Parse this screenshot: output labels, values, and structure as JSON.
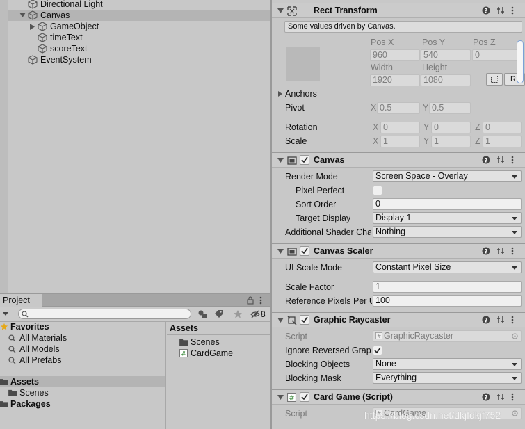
{
  "hierarchy": {
    "items": [
      {
        "label": "Directional Light"
      },
      {
        "label": "Canvas"
      },
      {
        "label": "GameObject"
      },
      {
        "label": "timeText"
      },
      {
        "label": "scoreText"
      },
      {
        "label": "EventSystem"
      }
    ]
  },
  "project": {
    "tab_label": "Project",
    "search": {
      "placeholder": "",
      "value": ""
    },
    "hidden_count": "8",
    "tree": {
      "favorites": "Favorites",
      "fav_items": [
        "All Materials",
        "All Models",
        "All Prefabs"
      ],
      "assets": "Assets",
      "asset_items": [
        "Scenes"
      ],
      "packages": "Packages"
    },
    "content": {
      "header": "Assets",
      "items": [
        "Scenes",
        "CardGame"
      ]
    }
  },
  "inspector": {
    "rect_transform": {
      "title": "Rect Transform",
      "info": "Some values driven by Canvas.",
      "col_headers": [
        "Pos X",
        "Pos Y",
        "Pos Z"
      ],
      "pos_values": [
        "960",
        "540",
        "0"
      ],
      "size_headers": [
        "Width",
        "Height"
      ],
      "size_values": [
        "1920",
        "1080"
      ],
      "r_button": "R",
      "anchors_label": "Anchors",
      "pivot_label": "Pivot",
      "pivot": {
        "x_label": "X",
        "x": "0.5",
        "y_label": "Y",
        "y": "0.5"
      },
      "rotation_label": "Rotation",
      "rotation": {
        "x": "0",
        "y": "0",
        "z": "0"
      },
      "scale_label": "Scale",
      "scale": {
        "x": "1",
        "y": "1",
        "z": "1"
      },
      "axis_x": "X",
      "axis_y": "Y",
      "axis_z": "Z"
    },
    "canvas": {
      "title": "Canvas",
      "render_mode_label": "Render Mode",
      "render_mode": "Screen Space - Overlay",
      "pixel_perfect_label": "Pixel Perfect",
      "sort_order_label": "Sort Order",
      "sort_order": "0",
      "target_display_label": "Target Display",
      "target_display": "Display 1",
      "shader_channels_label": "Additional Shader Channels",
      "shader_channels": "Nothing"
    },
    "canvas_scaler": {
      "title": "Canvas Scaler",
      "ui_scale_mode_label": "UI Scale Mode",
      "ui_scale_mode": "Constant Pixel Size",
      "scale_factor_label": "Scale Factor",
      "scale_factor": "1",
      "ref_ppu_label": "Reference Pixels Per Unit",
      "ref_ppu": "100"
    },
    "graphic_raycaster": {
      "title": "Graphic Raycaster",
      "script_label": "Script",
      "script_value": "GraphicRaycaster",
      "ignore_reversed_label": "Ignore Reversed Graphics",
      "blocking_objects_label": "Blocking Objects",
      "blocking_objects": "None",
      "blocking_mask_label": "Blocking Mask",
      "blocking_mask": "Everything"
    },
    "card_game": {
      "title": "Card Game (Script)",
      "script_label": "Script",
      "script_value": "CardGame"
    }
  },
  "watermark": "https://blog.csdn.net/dkjfdkjf752",
  "colors": {
    "panel_bg": "#c8c8c8",
    "selected_row": "#b4b4b4",
    "favorite_star": "#e6a817",
    "script_icon": "#3c8c3c"
  }
}
